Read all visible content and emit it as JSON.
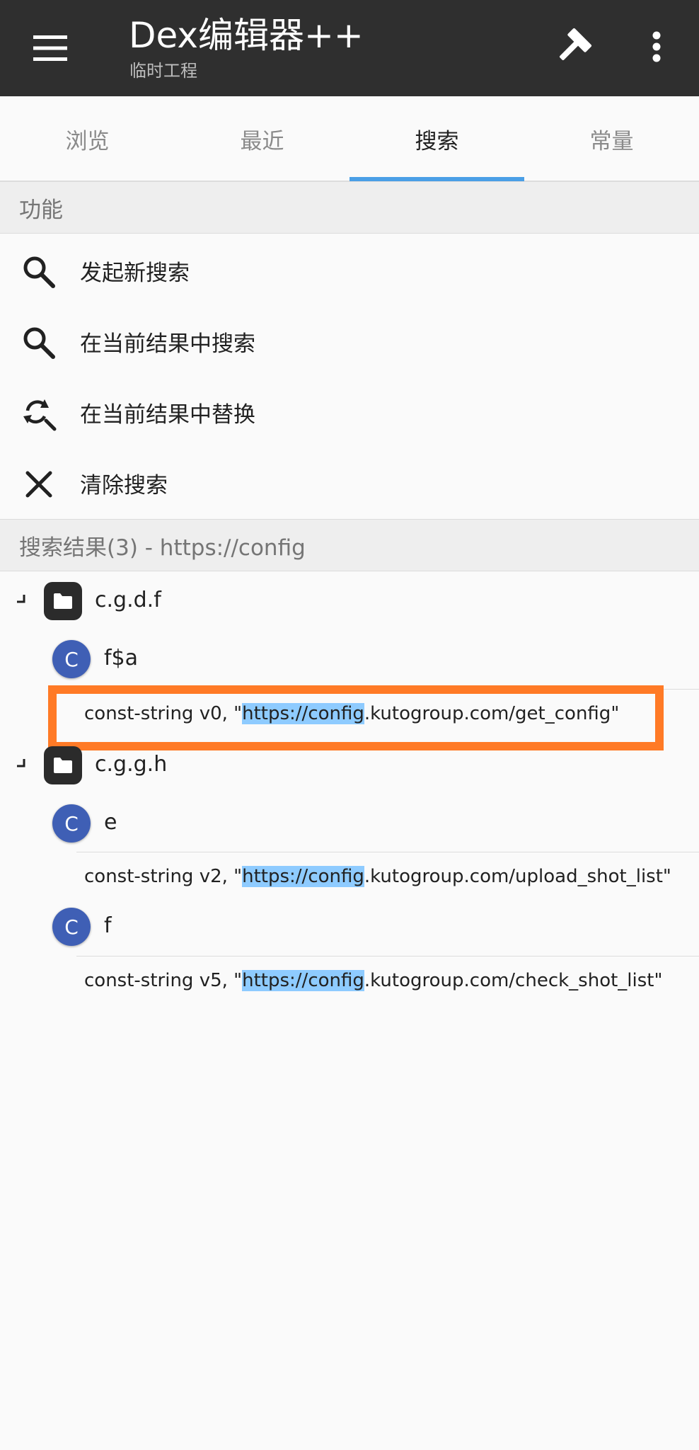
{
  "appbar": {
    "title": "Dex编辑器++",
    "subtitle": "临时工程"
  },
  "tabs": [
    {
      "label": "浏览",
      "active": false
    },
    {
      "label": "最近",
      "active": false
    },
    {
      "label": "搜索",
      "active": true
    },
    {
      "label": "常量",
      "active": false
    }
  ],
  "functions": {
    "header": "功能",
    "items": [
      {
        "label": "发起新搜索",
        "icon": "search-icon"
      },
      {
        "label": "在当前结果中搜索",
        "icon": "search-icon"
      },
      {
        "label": "在当前结果中替换",
        "icon": "replace-icon"
      },
      {
        "label": "清除搜索",
        "icon": "close-icon"
      }
    ]
  },
  "results": {
    "header": "搜索结果(3) - https://config",
    "packages": [
      {
        "name": "c.g.d.f",
        "classes": [
          {
            "badge": "C",
            "name": "f$a",
            "matches": [
              {
                "prefix": "const-string v0, \"",
                "highlight": "https://config",
                "suffix": ".kutogroup.com/get_config\""
              }
            ]
          }
        ]
      },
      {
        "name": "c.g.g.h",
        "classes": [
          {
            "badge": "C",
            "name": "e",
            "matches": [
              {
                "prefix": "const-string v2, \"",
                "highlight": "https://config",
                "suffix": ".kutogroup.com/upload_shot_list\""
              }
            ]
          },
          {
            "badge": "C",
            "name": "f",
            "matches": [
              {
                "prefix": "const-string v5, \"",
                "highlight": "https://config",
                "suffix": ".kutogroup.com/check_shot_list\""
              }
            ]
          }
        ]
      }
    ]
  },
  "colors": {
    "appbar": "#2f2f2f",
    "tab_indicator": "#4a9fe6",
    "class_badge": "#3f5fb5",
    "highlight": "#8ecbff",
    "focus_box": "#ff7a26"
  }
}
